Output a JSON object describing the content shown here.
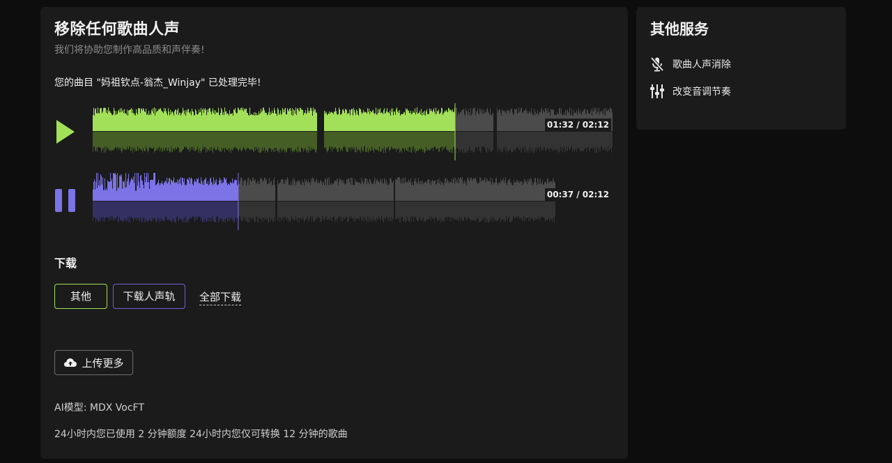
{
  "main": {
    "title": "移除任何歌曲人声",
    "subtitle": "我们将协助您制作高品质和声伴奏!",
    "status": "您的曲目 \"妈祖钦点-翁杰_Winjay\" 已处理完毕!",
    "tracks": [
      {
        "name": "instrumental",
        "state": "paused",
        "button_icon": "play-icon",
        "time": "01:32 / 02:12",
        "progress": 0.697,
        "color": "#a3e05a",
        "remaining_color": "#4a4a4a"
      },
      {
        "name": "vocals",
        "state": "playing",
        "button_icon": "pause-icon",
        "time": "00:37 / 02:12",
        "progress": 0.28,
        "color": "#7b73e6",
        "remaining_color": "#4a4a4a"
      }
    ],
    "download": {
      "heading": "下载",
      "other_label": "其他",
      "vocal_label": "下载人声轨",
      "all_label": "全部下载"
    },
    "upload_label": "上传更多",
    "upload_icon": "cloud-upload-icon",
    "model_info": "AI模型: MDX VocFT",
    "usage_info": "24小时内您已使用 2 分钟额度 24小时内您仅可转换 12 分钟的歌曲"
  },
  "sidebar": {
    "title": "其他服务",
    "items": [
      {
        "label": "歌曲人声消除",
        "icon": "microphone-off-icon"
      },
      {
        "label": "改变音调节奏",
        "icon": "sliders-icon"
      }
    ]
  },
  "colors": {
    "background": "#0d0d0d",
    "card": "#1b1b1b",
    "accent_green": "#a3e05a",
    "accent_purple": "#7b73e6"
  }
}
